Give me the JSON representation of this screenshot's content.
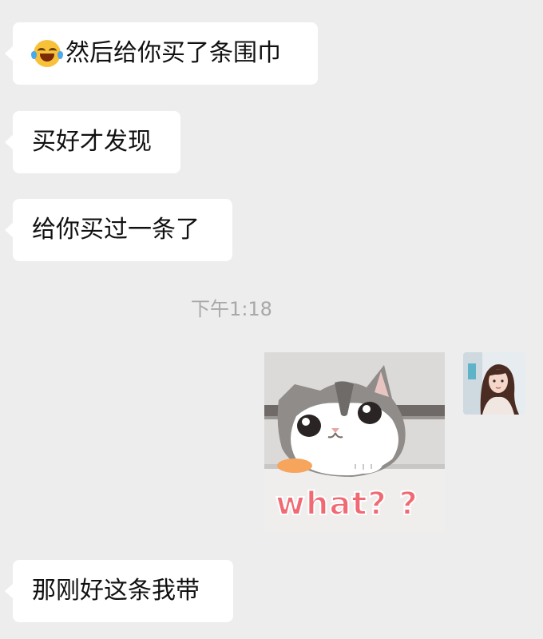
{
  "messages": [
    {
      "text": "然后给你买了条围巾",
      "emoji": "face-with-tears-of-joy"
    },
    {
      "text": "买好才发现"
    },
    {
      "text": "给你买过一条了"
    },
    {
      "text": "那刚好这条我带"
    }
  ],
  "timestamp": "下午1:18",
  "sticker": {
    "caption": "what? ?",
    "subject": "cat-peeking-icon"
  },
  "colors": {
    "background": "#ededed",
    "bubble": "#ffffff",
    "caption": "#f06a74",
    "timestamp": "#a8a8a8"
  }
}
